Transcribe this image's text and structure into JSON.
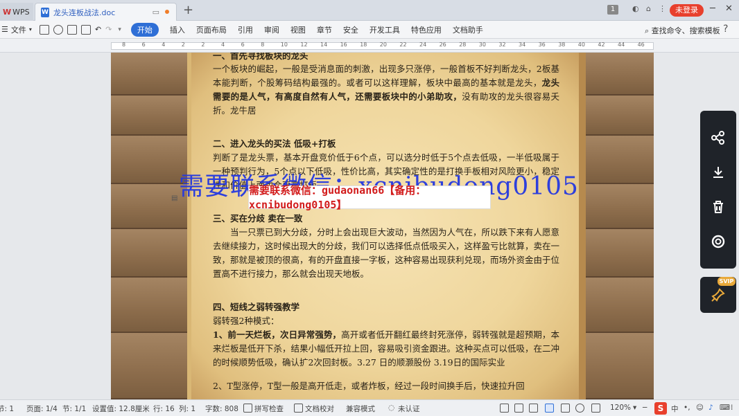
{
  "titlebar": {
    "app_tab": "WPS",
    "doc_tab": "龙头连板战法.doc",
    "login_button": "未登录",
    "page_badge": "1"
  },
  "menubar": {
    "file": "文件",
    "items": [
      "开始",
      "插入",
      "页面布局",
      "引用",
      "审阅",
      "视图",
      "章节",
      "安全",
      "开发工具",
      "特色应用",
      "文档助手"
    ],
    "active_index": 0,
    "search_command": "查找命令、搜索模板",
    "help": "?"
  },
  "ruler": {
    "numbers": [
      "8",
      "6",
      "4",
      "2",
      "2",
      "4",
      "6",
      "8",
      "10",
      "12",
      "14",
      "16",
      "18",
      "20",
      "22",
      "24",
      "26",
      "28",
      "30",
      "32",
      "34",
      "36",
      "38",
      "40",
      "42",
      "44",
      "46"
    ]
  },
  "document": {
    "top_heading": "一、首先寻找板块的龙头",
    "p1": "一个板块的崛起，一般是受消息面的刺激，出现多只涨停，一般首板不好判断龙头，2板基本能判断，个股筹码结构最强的。或者可以这样理解，板块中最高的基本就是龙头，",
    "p1_bold": "龙头需要的是人气，有高度自然有人气，还需要板块中的小弟助攻，",
    "p1_tail": "没有助攻的龙头很容易夭折。龙牛居",
    "h2": "二、进入龙头的买法    低吸+打板",
    "p2": "判断了是龙头票，基本开盘竞价低于6个点，可以选分时低于5个点去低吸，一半低吸属于一种预判行为，5个点以下低吸，性价比高，其实确定性的是打换手板相对风险更小，稳定性和价值上面也会更高打板。",
    "h3": "三、买在分歧 卖在一致",
    "p3": "当一只票已到大分歧，分时上会出现巨大波动，当然因为人气在，所以跌下来有人愿意去继续接力，这时候出现大的分歧，我们可以选择低点低吸买入，这样盈亏比就算，卖在一致，那就是被顶的很高，有的开盘直接一字板，这种容易出现获利兑现，而场外资金由于位置高不进行接力，那么就会出现天地板。",
    "h4": "四、短线之弱转强教学",
    "p4a": "弱转强2种模式：",
    "p4b_bold": "1、前一天烂板，次日异常强势，",
    "p4b": "高开或者低开翻红最终封死涨停，弱转强就是超预期，本来烂板是低开下杀，结果小幅低开拉上回，容易吸引资金跟进。这种买点可以低吸，在二冲的时候顺势低吸，确认扩2次回封板。3.27 日的顺灏股份 3.19日的国际实业",
    "p5": "2、T型涨停，T型一般是高开低走，或者炸板，经过一段时间换手后，快速拉升回"
  },
  "watermark": {
    "big": "需要联系微信：xcnibudong0105",
    "box": "需要联系微信：gudaonan66【备用：xcnibudong0105】"
  },
  "float_toolbar": {
    "icons": [
      "share-icon",
      "download-icon",
      "delete-icon",
      "target-icon"
    ],
    "svip_badge": "SVIP"
  },
  "statusbar": {
    "section_label": "节: 1",
    "page": "页面: 1/4",
    "section": "节: 1/1",
    "setting": "设置值: 12.8厘米",
    "row": "行: 16",
    "col": "列: 1",
    "word_count": "字数: 808",
    "spell_check": "拼写检查",
    "doc_proof": "文档校对",
    "compat_mode": "兼容模式",
    "cert": "未认证",
    "zoom": "120%",
    "ime": "中"
  },
  "colors": {
    "accent": "#2f6fd6",
    "login": "#e8402d",
    "watermark_blue": "#2438e0",
    "watermark_red": "#d21c1c"
  }
}
